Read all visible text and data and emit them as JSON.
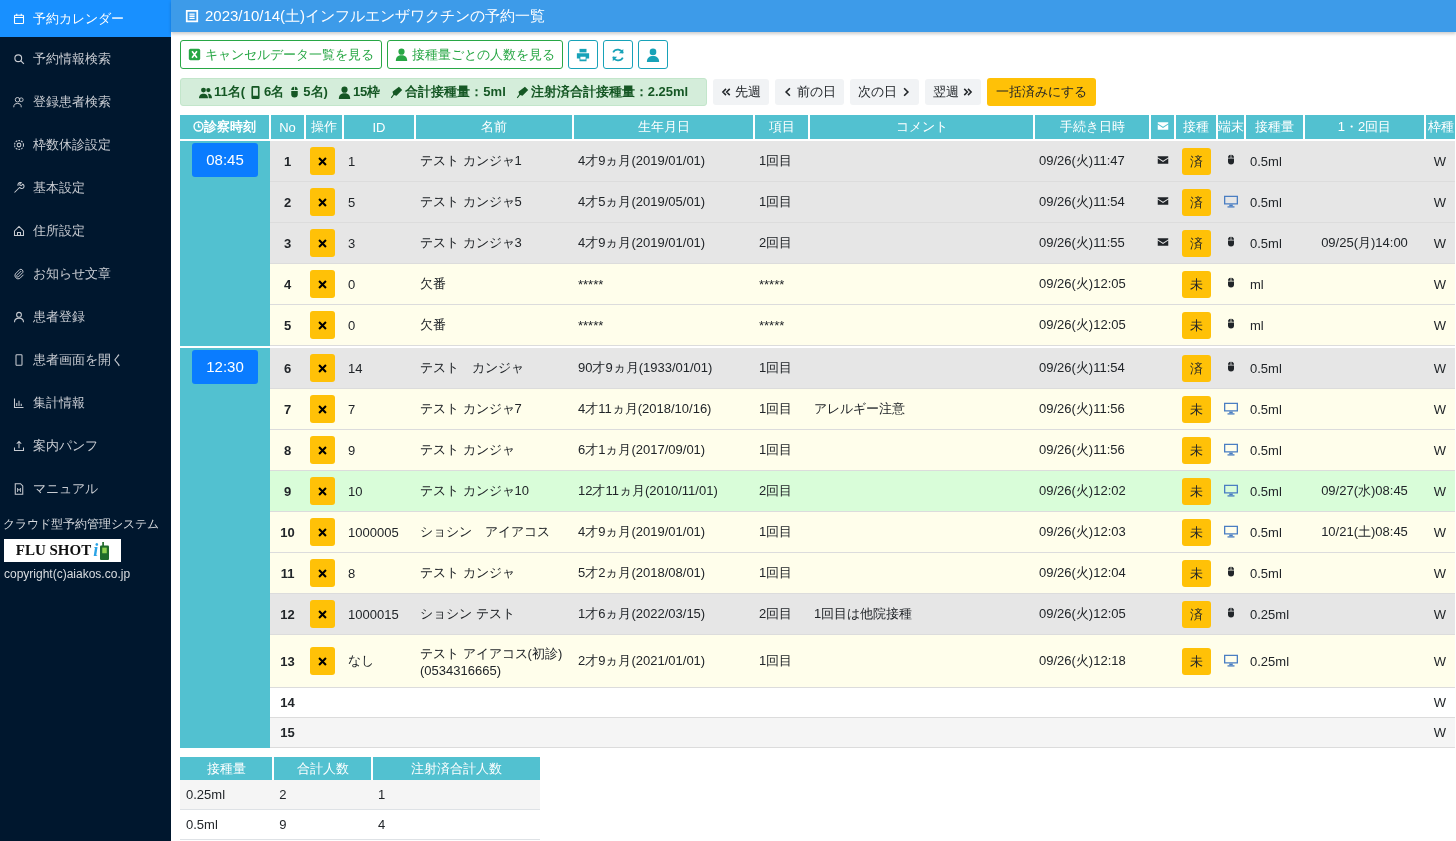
{
  "sidebar": {
    "items": [
      {
        "label": "予約カレンダー",
        "selected": true
      },
      {
        "label": "予約情報検索",
        "selected": false
      },
      {
        "label": "登録患者検索",
        "selected": false
      },
      {
        "label": "枠数休診設定",
        "selected": false
      },
      {
        "label": "基本設定",
        "selected": false
      },
      {
        "label": "住所設定",
        "selected": false
      },
      {
        "label": "お知らせ文章",
        "selected": false
      },
      {
        "label": "患者登録",
        "selected": false
      },
      {
        "label": "患者画面を開く",
        "selected": false
      },
      {
        "label": "集計情報",
        "selected": false
      },
      {
        "label": "案内パンフ",
        "selected": false
      },
      {
        "label": "マニュアル",
        "selected": false
      }
    ],
    "system_name": "クラウド型予約管理システム",
    "logo": {
      "text": "FLU SHOT",
      "letter": "i"
    },
    "copyright": "copyright(c)aiakos.co.jp"
  },
  "header": {
    "title": "2023/10/14(土)インフルエンザワクチンの予約一覧"
  },
  "toolbar": {
    "buttons": [
      {
        "kind": "text",
        "label": "キャンセルデータ一覧を見る"
      },
      {
        "kind": "text",
        "label": "接種量ごとの人数を見る"
      },
      {
        "kind": "icon"
      },
      {
        "kind": "icon"
      },
      {
        "kind": "icon"
      }
    ]
  },
  "summary": [
    "11名(",
    "6名",
    "5名)",
    "15枠",
    "合計接種量：5ml",
    "注射済合計接種量：2.25ml"
  ],
  "nav": [
    "先週",
    "前の日",
    "次の日",
    "翌週"
  ],
  "bulk_button": "一括済みにする",
  "table": {
    "columns": [
      "診察時刻",
      "No",
      "操作",
      "ID",
      "名前",
      "生年月日",
      "項目",
      "コメント",
      "手続き日時",
      "",
      "接種",
      "端末",
      "接種量",
      "1・2回目",
      "枠種"
    ],
    "slots": [
      {
        "time": "08:45",
        "rows": [
          {
            "kind": "booking",
            "no": "1",
            "id": "1",
            "name": "テスト カンジャ1",
            "birth": "4才9ヵ月(2019/01/01)",
            "item": "1回目",
            "time": "09/26(火)11:47",
            "mail": true,
            "status": "済",
            "web": false,
            "dose": "0.5ml",
            "frame": "W",
            "color": "#e6e6e6"
          },
          {
            "kind": "booking",
            "no": "2",
            "id": "5",
            "name": "テスト カンジャ5",
            "birth": "4才5ヵ月(2019/05/01)",
            "item": "1回目",
            "time": "09/26(火)11:54",
            "mail": true,
            "status": "済",
            "web": true,
            "dose": "0.5ml",
            "frame": "W",
            "color": "#e6e6e6"
          },
          {
            "kind": "booking",
            "no": "3",
            "id": "3",
            "name": "テスト カンジャ3",
            "birth": "4才9ヵ月(2019/01/01)",
            "item": "2回目",
            "time": "09/26(火)11:55",
            "mail": true,
            "status": "済",
            "web": false,
            "dose": "0.5ml",
            "second": "09/25(月)14:00",
            "frame": "W",
            "color": "#e6e6e6"
          },
          {
            "kind": "booking",
            "no": "4",
            "id": "0",
            "name": "欠番",
            "birth": "*****",
            "item": "*****",
            "time": "09/26(火)12:05",
            "mail": false,
            "status": "未",
            "web": false,
            "dose": "ml",
            "frame": "W",
            "color": "#fffeeb"
          },
          {
            "kind": "booking",
            "no": "5",
            "id": "0",
            "name": "欠番",
            "birth": "*****",
            "item": "*****",
            "time": "09/26(火)12:05",
            "mail": false,
            "status": "未",
            "web": false,
            "dose": "ml",
            "frame": "W",
            "color": "#fffeeb"
          }
        ]
      },
      {
        "time": "12:30",
        "rows": [
          {
            "kind": "booking",
            "no": "6",
            "id": "14",
            "name": "テスト　カンジャ",
            "birth": "90才9ヵ月(1933/01/01)",
            "item": "1回目",
            "time": "09/26(火)11:54",
            "mail": false,
            "status": "済",
            "web": false,
            "dose": "0.5ml",
            "frame": "W",
            "color": "#e6e6e6"
          },
          {
            "kind": "booking",
            "no": "7",
            "id": "7",
            "name": "テスト カンジャ7",
            "birth": "4才11ヵ月(2018/10/16)",
            "item": "1回目",
            "comment": "アレルギー注意",
            "time": "09/26(火)11:56",
            "mail": false,
            "status": "未",
            "web": true,
            "dose": "0.5ml",
            "frame": "W",
            "color": "#fffeeb"
          },
          {
            "kind": "booking",
            "no": "8",
            "id": "9",
            "name": "テスト カンジャ",
            "birth": "6才1ヵ月(2017/09/01)",
            "item": "1回目",
            "time": "09/26(火)11:56",
            "mail": false,
            "status": "未",
            "web": true,
            "dose": "0.5ml",
            "frame": "W",
            "color": "#fffeeb"
          },
          {
            "kind": "booking",
            "no": "9",
            "id": "10",
            "name": "テスト カンジャ10",
            "birth": "12才11ヵ月(2010/11/01)",
            "item": "2回目",
            "time": "09/26(火)12:02",
            "mail": false,
            "status": "未",
            "web": true,
            "dose": "0.5ml",
            "second": "09/27(水)08:45",
            "frame": "W",
            "color": "#d9fdd9"
          },
          {
            "kind": "booking",
            "no": "10",
            "id": "1000005",
            "name": "ショシン　アイアコス",
            "birth": "4才9ヵ月(2019/01/01)",
            "item": "1回目",
            "time": "09/26(火)12:03",
            "mail": false,
            "status": "未",
            "web": true,
            "dose": "0.5ml",
            "second": "10/21(土)08:45",
            "frame": "W",
            "color": "#fffeeb"
          },
          {
            "kind": "booking",
            "no": "11",
            "id": "8",
            "name": "テスト カンジャ",
            "birth": "5才2ヵ月(2018/08/01)",
            "item": "1回目",
            "time": "09/26(火)12:04",
            "mail": false,
            "status": "未",
            "web": false,
            "dose": "0.5ml",
            "frame": "W",
            "color": "#fffeeb"
          },
          {
            "kind": "booking",
            "no": "12",
            "id": "1000015",
            "name": "ショシン テスト",
            "birth": "1才6ヵ月(2022/03/15)",
            "item": "2回目",
            "comment": "1回目は他院接種",
            "time": "09/26(火)12:05",
            "mail": false,
            "status": "済",
            "web": false,
            "dose": "0.25ml",
            "frame": "W",
            "color": "#e6e6e6"
          },
          {
            "kind": "booking",
            "no": "13",
            "id": "なし",
            "name": "テスト アイアコス(初診)(0534316665)",
            "birth": "2才9ヵ月(2021/01/01)",
            "item": "1回目",
            "time": "09/26(火)12:18",
            "mail": false,
            "status": "未",
            "web": true,
            "dose": "0.25ml",
            "frame": "W",
            "color": "#fffeeb"
          },
          {
            "kind": "empty",
            "no": "14",
            "frame": "W",
            "color": "#ffffff"
          },
          {
            "kind": "empty",
            "no": "15",
            "frame": "W",
            "color": "#f5f5f5"
          }
        ]
      }
    ]
  },
  "dose_table": {
    "columns": [
      "接種量",
      "合計人数",
      "注射済合計人数"
    ],
    "rows": [
      [
        "0.25ml",
        "2",
        "1"
      ],
      [
        "0.5ml",
        "9",
        "4"
      ]
    ]
  }
}
